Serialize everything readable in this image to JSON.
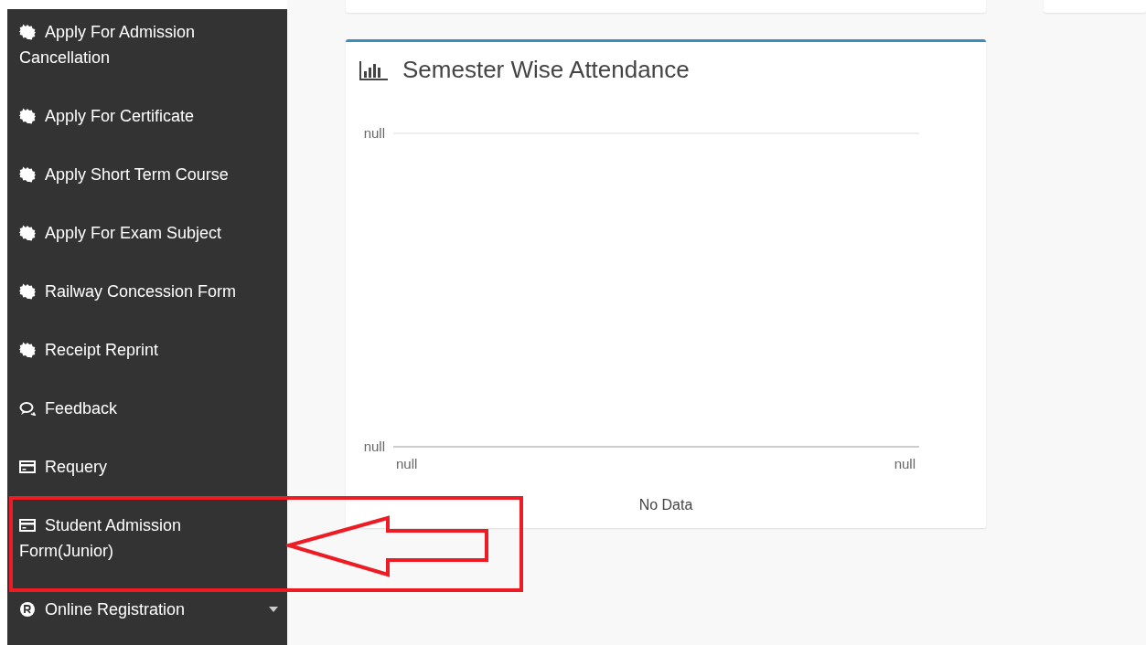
{
  "sidebar": {
    "items": [
      {
        "label": "Apply For Admission Cancellation",
        "kind": "badge",
        "selected": false
      },
      {
        "label": "Apply For Certificate",
        "kind": "badge",
        "selected": false
      },
      {
        "label": "Apply Short Term Course",
        "kind": "badge",
        "selected": false
      },
      {
        "label": "Apply For Exam Subject",
        "kind": "badge",
        "selected": false
      },
      {
        "label": "Railway Concession Form",
        "kind": "badge",
        "selected": false
      },
      {
        "label": "Receipt Reprint",
        "kind": "badge",
        "selected": false
      },
      {
        "label": "Feedback",
        "kind": "comments",
        "selected": false
      },
      {
        "label": "Requery",
        "kind": "card",
        "selected": false
      },
      {
        "label": "Student Admission Form(Junior)",
        "kind": "card",
        "selected": false
      },
      {
        "label": "Online Registration",
        "kind": "registered",
        "selected": false,
        "has_submenu": true
      }
    ]
  },
  "attendance_card": {
    "title": "Semester Wise Attendance",
    "y_labels": [
      "null",
      "null"
    ],
    "x_labels": [
      "null",
      "null"
    ],
    "message": "No Data"
  },
  "annotation": {
    "kind": "box-arrow"
  }
}
